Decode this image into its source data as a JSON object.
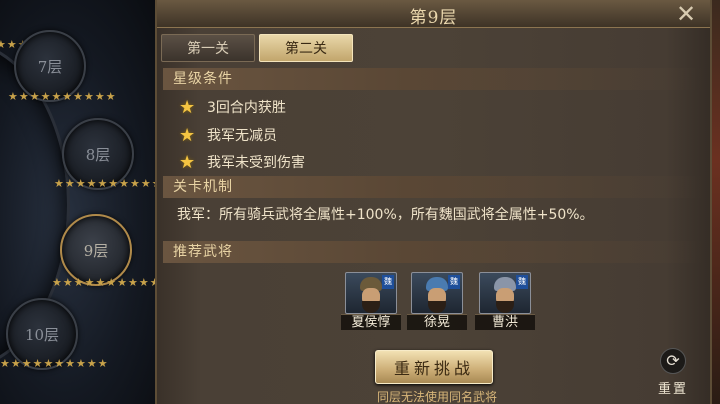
{
  "tower": {
    "floors": [
      {
        "label": "7层",
        "stars": "★★★★★★★★★★"
      },
      {
        "label": "8层",
        "stars": "★★★★★★★★★★"
      },
      {
        "label": "9层",
        "stars": "★★★★★★★★★★"
      },
      {
        "label": "10层",
        "stars": "★★★★★★★★★★"
      }
    ],
    "top_stars": "★★★"
  },
  "panel": {
    "title": "第9层",
    "tabs": [
      {
        "label": "第一关",
        "active": false
      },
      {
        "label": "第二关",
        "active": true
      }
    ],
    "star_section": {
      "title": "星级条件",
      "conditions": [
        "3回合内获胜",
        "我军无减员",
        "我军未受到伤害"
      ]
    },
    "mechanic_section": {
      "title": "关卡机制",
      "text": "我军：所有骑兵武将全属性+100%，所有魏国武将全属性+50%。"
    },
    "heroes_section": {
      "title": "推荐武将",
      "heroes": [
        {
          "name": "夏侯惇",
          "faction": "魏",
          "helmet": "#6b5a3a"
        },
        {
          "name": "徐晃",
          "faction": "魏",
          "helmet": "#4a7bb0"
        },
        {
          "name": "曹洪",
          "faction": "魏",
          "helmet": "#8a95a8"
        }
      ]
    },
    "restart_label": "重新挑战",
    "restart_note": "同层无法使用同名武将",
    "reset_label": "重置"
  },
  "colors": {
    "accent_gold": "#c8a24a",
    "star": "#f5c542",
    "faction_wei": "#1f4f9a"
  }
}
